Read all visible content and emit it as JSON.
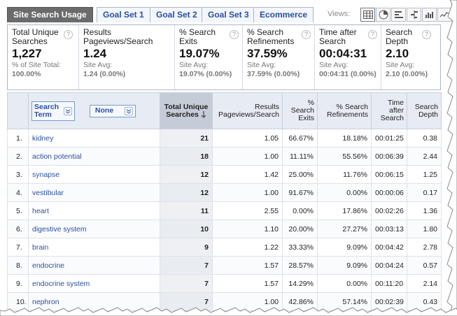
{
  "tabs": [
    {
      "label": "Site Search Usage",
      "active": true
    },
    {
      "label": "Goal Set 1",
      "active": false
    },
    {
      "label": "Goal Set 2",
      "active": false
    },
    {
      "label": "Goal Set 3",
      "active": false
    },
    {
      "label": "Ecommerce",
      "active": false
    }
  ],
  "views": {
    "label": "Views:",
    "icons": [
      "table-view-icon",
      "pie-view-icon",
      "bar-view-icon",
      "comparison-view-icon",
      "pivot-view-icon"
    ]
  },
  "metrics": [
    {
      "title": "Total Unique Searches",
      "value": "1,227",
      "sub_label": "% of Site Total:",
      "sub_value": "100.00%"
    },
    {
      "title": "Results Pageviews/Search",
      "value": "1.24",
      "sub_label": "Site Avg:",
      "sub_value": "1.24 (0.00%)"
    },
    {
      "title": "% Search Exits",
      "value": "19.07%",
      "sub_label": "Site Avg:",
      "sub_value": "19.07% (0.00%)"
    },
    {
      "title": "% Search Refinements",
      "value": "37.59%",
      "sub_label": "Site Avg:",
      "sub_value": "37.59% (0.00%)"
    },
    {
      "title": "Time after Search",
      "value": "00:04:31",
      "sub_label": "Site Avg:",
      "sub_value": "00:04:31 (0.00%)"
    },
    {
      "title": "Search Depth",
      "value": "2.10",
      "sub_label": "Site Avg:",
      "sub_value": "2.10 (0.00%)"
    }
  ],
  "table": {
    "primary_dimension": "Search Term",
    "secondary_dimension": "None",
    "headers": [
      "Total Unique Searches",
      "Results Pageviews/Search",
      "% Search Exits",
      "% Search Refinements",
      "Time after Search",
      "Search Depth"
    ],
    "rows": [
      {
        "num": "1.",
        "term": "kidney",
        "vals": [
          "21",
          "1.05",
          "66.67%",
          "18.18%",
          "00:01:25",
          "0.38"
        ]
      },
      {
        "num": "2.",
        "term": "action potential",
        "vals": [
          "18",
          "1.00",
          "11.11%",
          "55.56%",
          "00:06:39",
          "2.44"
        ]
      },
      {
        "num": "3.",
        "term": "synapse",
        "vals": [
          "12",
          "1.42",
          "25.00%",
          "11.76%",
          "00:06:15",
          "1.25"
        ]
      },
      {
        "num": "4.",
        "term": "vestibular",
        "vals": [
          "12",
          "1.00",
          "91.67%",
          "0.00%",
          "00:00:06",
          "0.17"
        ]
      },
      {
        "num": "5.",
        "term": "heart",
        "vals": [
          "11",
          "2.55",
          "0.00%",
          "17.86%",
          "00:02:26",
          "1.36"
        ]
      },
      {
        "num": "6.",
        "term": "digestive system",
        "vals": [
          "10",
          "1.10",
          "20.00%",
          "27.27%",
          "00:03:13",
          "1.80"
        ]
      },
      {
        "num": "7.",
        "term": "brain",
        "vals": [
          "9",
          "1.22",
          "33.33%",
          "9.09%",
          "00:04:42",
          "2.78"
        ]
      },
      {
        "num": "8.",
        "term": "endocrine",
        "vals": [
          "7",
          "1.57",
          "28.57%",
          "9.09%",
          "00:04:24",
          "0.57"
        ]
      },
      {
        "num": "9.",
        "term": "endocrine system",
        "vals": [
          "7",
          "1.57",
          "14.29%",
          "0.00%",
          "00:11:20",
          "2.14"
        ]
      },
      {
        "num": "10.",
        "term": "nephron",
        "vals": [
          "7",
          "1.00",
          "42.86%",
          "57.14%",
          "00:02:39",
          "0.43"
        ]
      }
    ]
  },
  "colors": {
    "accent_link": "#2a4fa0",
    "active_tab": "#6b6b6b",
    "header_bg": "#e7ebf3",
    "sorted_header_bg": "#c6ccd7"
  }
}
